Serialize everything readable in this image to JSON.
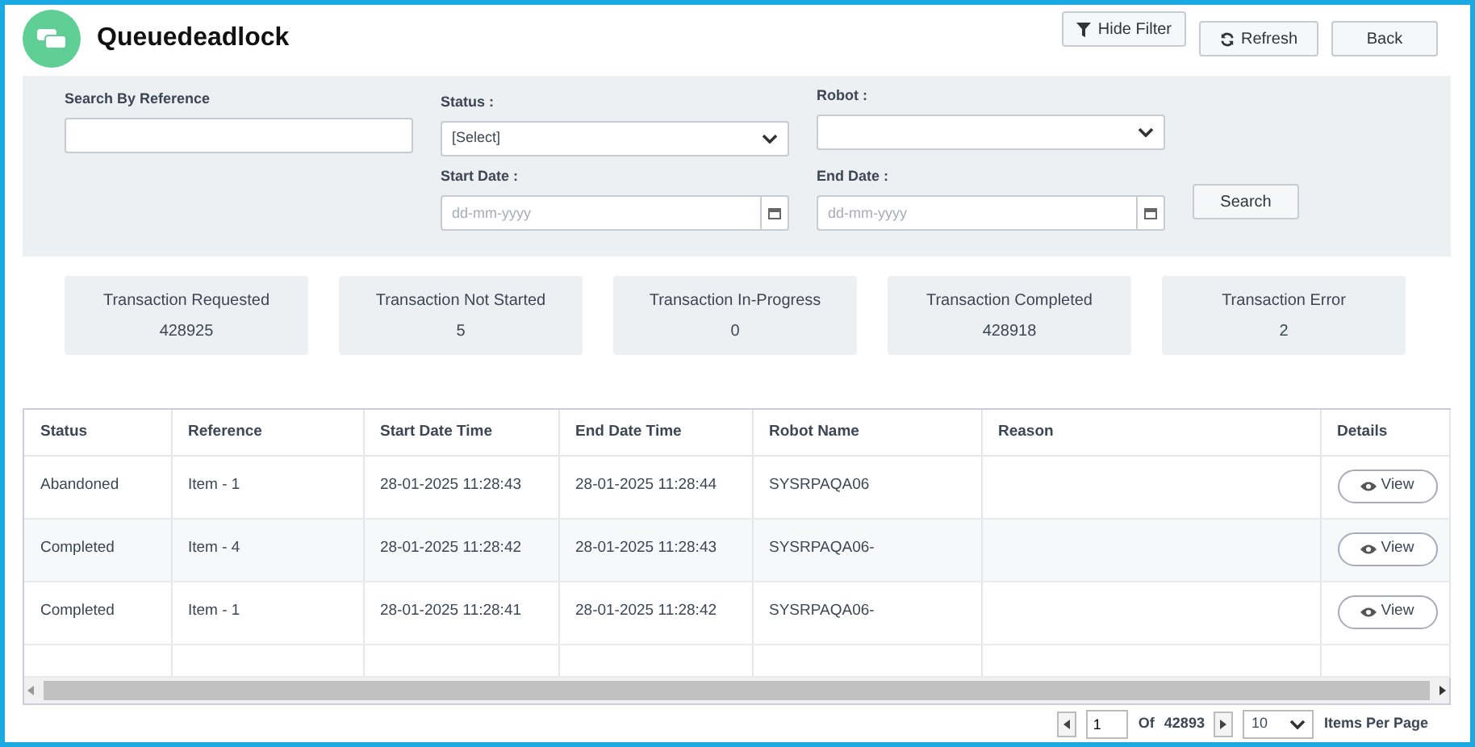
{
  "header": {
    "title": "Queuedeadlock",
    "buttons": [
      {
        "label": "Hide Filter",
        "kind": "filter"
      },
      {
        "label": "Refresh",
        "kind": "refresh"
      },
      {
        "label": "Back",
        "kind": "plain"
      }
    ]
  },
  "filters": {
    "reference": {
      "label": "Search By Reference"
    },
    "status": {
      "label": "Status :",
      "value": "[Select]"
    },
    "robot": {
      "label": "Robot :"
    },
    "start_date": {
      "label": "Start Date :",
      "placeholder": "dd-mm-yyyy"
    },
    "end_date": {
      "label": "End Date :",
      "placeholder": "dd-mm-yyyy"
    },
    "search_button": "Search"
  },
  "stats": [
    {
      "label": "Transaction Requested",
      "value": "428925"
    },
    {
      "label": "Transaction Not Started",
      "value": "5"
    },
    {
      "label": "Transaction In-Progress",
      "value": "0"
    },
    {
      "label": "Transaction Completed",
      "value": "428918"
    },
    {
      "label": "Transaction Error",
      "value": "2"
    }
  ],
  "table": {
    "columns": [
      "Status",
      "Reference",
      "Start Date Time",
      "End Date Time",
      "Robot Name",
      "Reason",
      "Details"
    ],
    "rows": [
      {
        "status": "Abandoned",
        "reference": "Item - 1",
        "start": "28-01-2025 11:28:43",
        "end": "28-01-2025 11:28:44",
        "robot": "SYSRPAQA06",
        "details": "View"
      },
      {
        "status": "Completed",
        "reference": "Item - 4",
        "start": "28-01-2025 11:28:42",
        "end": "28-01-2025 11:28:43",
        "robot": "SYSRPAQA06-",
        "details": "View"
      },
      {
        "status": "Completed",
        "reference": "Item - 1",
        "start": "28-01-2025 11:28:41",
        "end": "28-01-2025 11:28:42",
        "robot": "SYSRPAQA06-",
        "details": "View"
      }
    ]
  },
  "pagination": {
    "page": "1",
    "of_label": "Of",
    "total_pages": "42893",
    "per_page": "10",
    "per_page_label": "Items Per Page"
  }
}
